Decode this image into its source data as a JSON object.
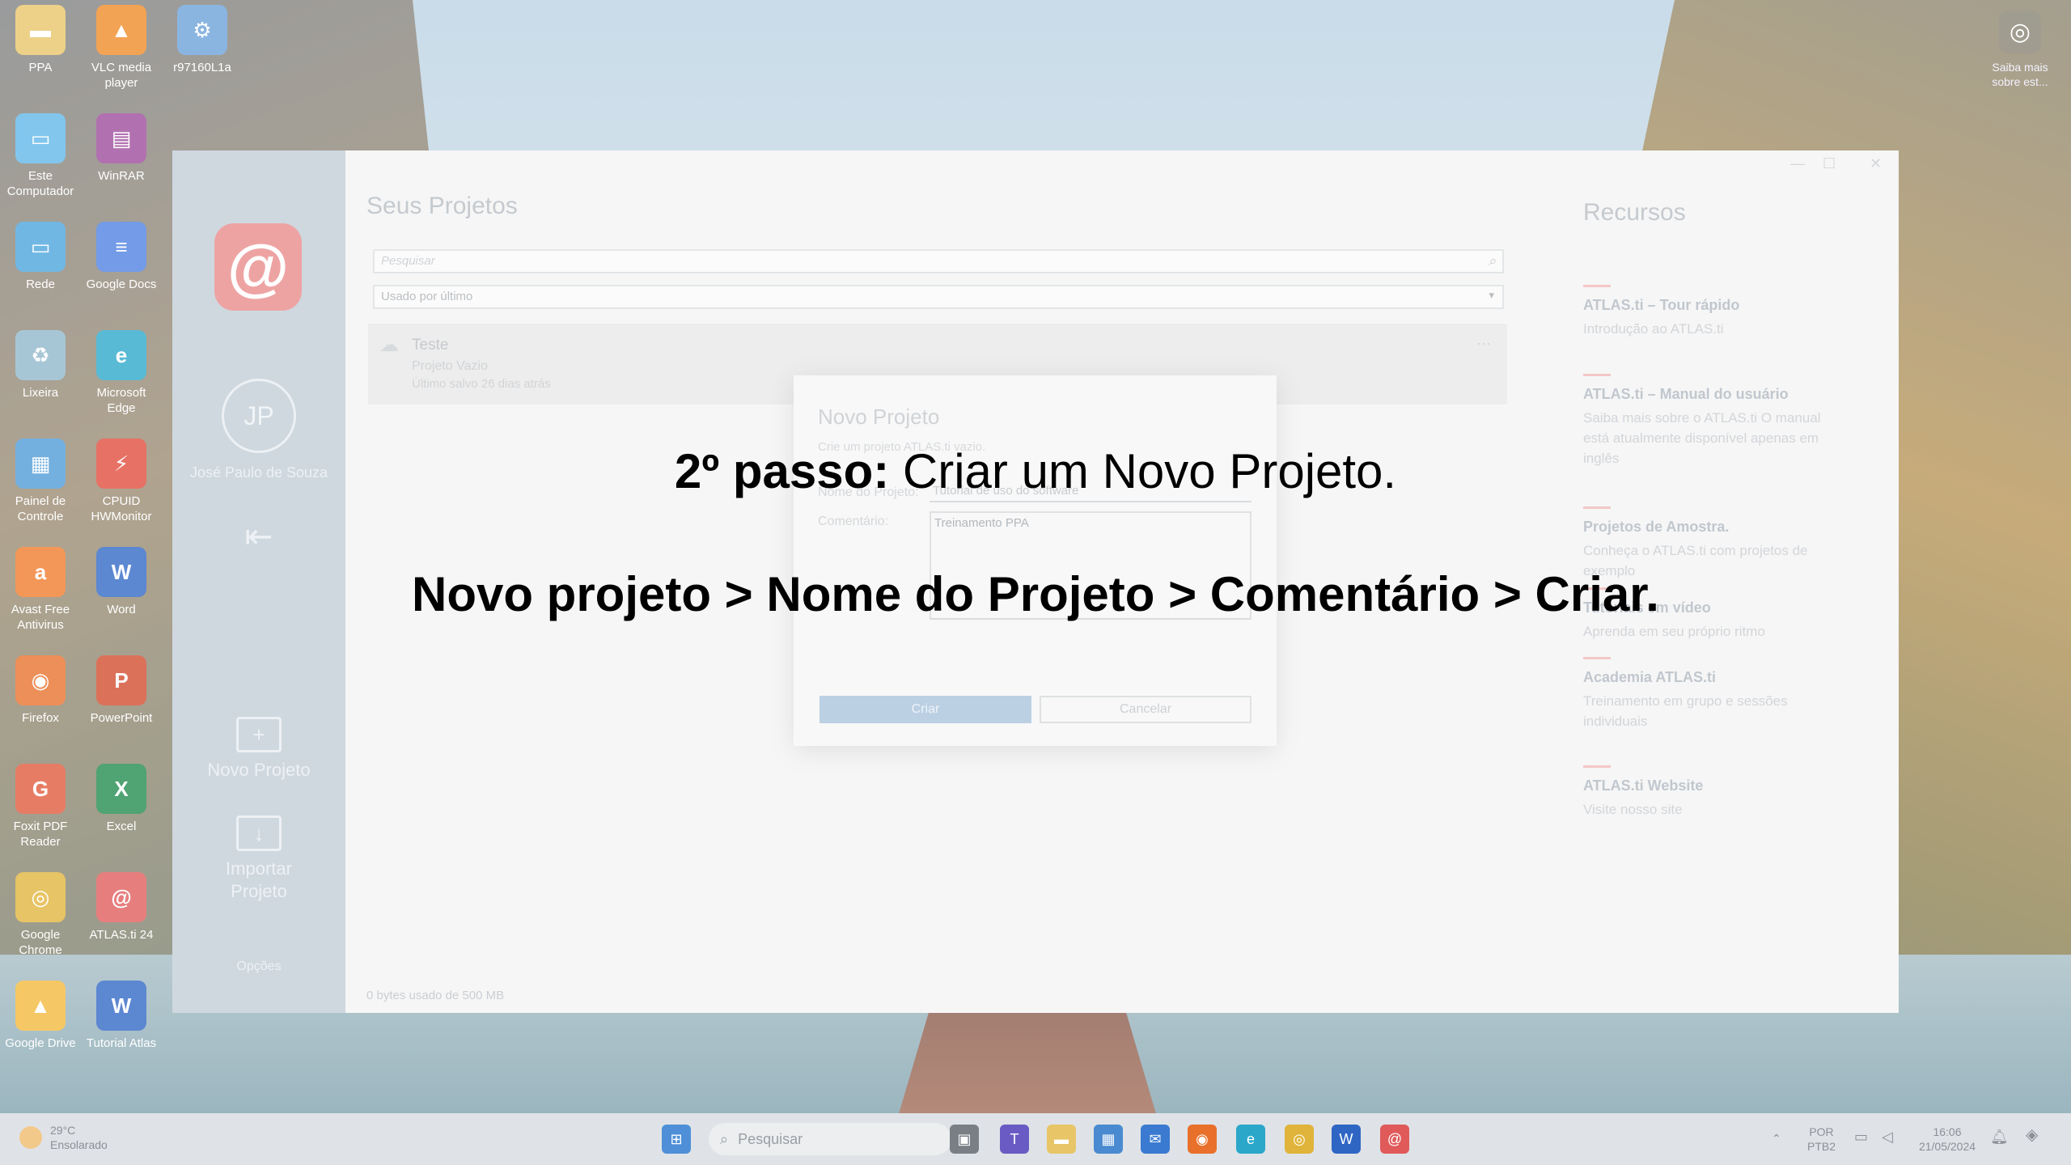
{
  "desktop": {
    "icons": [
      {
        "label": "PPA",
        "icon": "folder-icon",
        "color": "#e8c567",
        "glyph": "▬"
      },
      {
        "label": "VLC media player",
        "icon": "vlc-icon",
        "color": "#f08a24",
        "glyph": "▲"
      },
      {
        "label": "r97160L1a",
        "icon": "installer-icon",
        "color": "#6aa0d8",
        "glyph": "⚙"
      },
      {
        "label": "Este Computador",
        "icon": "computer-icon",
        "color": "#5fb7e8",
        "glyph": "▭"
      },
      {
        "label": "WinRAR",
        "icon": "winrar-icon",
        "color": "#9b4a9a",
        "glyph": "▤"
      },
      {
        "label": "Rede",
        "icon": "network-icon",
        "color": "#4aa3dd",
        "glyph": "▭"
      },
      {
        "label": "Google Docs",
        "icon": "google-docs-icon",
        "color": "#4c7fe0",
        "glyph": "≡"
      },
      {
        "label": "Lixeira",
        "icon": "recycle-bin-icon",
        "color": "#8fb6c9",
        "glyph": "♻"
      },
      {
        "label": "Microsoft Edge",
        "icon": "edge-icon",
        "color": "#2aa7c9",
        "glyph": "e"
      },
      {
        "label": "Painel de Controle",
        "icon": "control-panel-icon",
        "color": "#4d9ad6",
        "glyph": "▦"
      },
      {
        "label": "CPUID HWMonitor",
        "icon": "hwmonitor-icon",
        "color": "#e04a3a",
        "glyph": "⚡"
      },
      {
        "label": "Avast Free Antivirus",
        "icon": "avast-icon",
        "color": "#f07a2a",
        "glyph": "a"
      },
      {
        "label": "Word",
        "icon": "word-icon",
        "color": "#2f66c4",
        "glyph": "W"
      },
      {
        "label": "Firefox",
        "icon": "firefox-icon",
        "color": "#e8702a",
        "glyph": "◉"
      },
      {
        "label": "PowerPoint",
        "icon": "powerpoint-icon",
        "color": "#d24a2c",
        "glyph": "P"
      },
      {
        "label": "Foxit PDF Reader",
        "icon": "foxit-icon",
        "color": "#e0583a",
        "glyph": "G"
      },
      {
        "label": "Excel",
        "icon": "excel-icon",
        "color": "#1f8a4c",
        "glyph": "X"
      },
      {
        "label": "Google Chrome",
        "icon": "chrome-icon",
        "color": "#e0b43a",
        "glyph": "◎"
      },
      {
        "label": "ATLAS.ti 24",
        "icon": "atlas-ti-icon",
        "color": "#e05a5a",
        "glyph": "@"
      },
      {
        "label": "Google Drive",
        "icon": "google-drive-icon",
        "color": "#f2b93a",
        "glyph": "▲"
      },
      {
        "label": "Tutorial Atlas",
        "icon": "word-document-icon",
        "color": "#2f66c4",
        "glyph": "W"
      }
    ],
    "top_right": {
      "label": "Saiba mais sobre est...",
      "icon": "camera-icon"
    }
  },
  "app": {
    "logo": "@",
    "avatar_initials": "JP",
    "user_name": "José Paulo de Souza",
    "sidebar": {
      "new_project": "Novo Projeto",
      "import_project": "Importar Projeto",
      "options": "Opções"
    },
    "main": {
      "title": "Seus Projetos",
      "search_placeholder": "Pesquisar",
      "sort_value": "Usado por último",
      "project": {
        "name": "Teste",
        "type": "Projeto Vazio",
        "saved": "Último salvo 26 dias atrás"
      },
      "usage": "0 bytes usado de 500 MB"
    },
    "resources": {
      "title": "Recursos",
      "items": [
        {
          "title": "ATLAS.ti – Tour rápido",
          "desc": "Introdução ao ATLAS.ti"
        },
        {
          "title": "ATLAS.ti – Manual do usuário",
          "desc": "Saiba mais sobre o ATLAS.ti O manual está atualmente disponível apenas em inglês"
        },
        {
          "title": "Projetos de Amostra.",
          "desc": "Conheça o ATLAS.ti com projetos de exemplo"
        },
        {
          "title": "Tutoriais em vídeo",
          "desc": "Aprenda em seu próprio ritmo"
        },
        {
          "title": "Academia ATLAS.ti",
          "desc": "Treinamento em grupo e sessões individuais"
        },
        {
          "title": "ATLAS.ti Website",
          "desc": "Visite nosso site"
        }
      ]
    },
    "dialog": {
      "title": "Novo Projeto",
      "subtitle": "Crie um projeto ATLAS.ti vazio.",
      "name_label": "Nome do Projeto:",
      "name_value": "Tutorial de uso do software",
      "comment_label": "Comentário:",
      "comment_value": "Treinamento PPA",
      "create": "Criar",
      "cancel": "Cancelar"
    }
  },
  "overlay": {
    "step_bold": "2º passo:",
    "step_text": " Criar um Novo Projeto.",
    "path": "Novo projeto > Nome do Projeto > Comentário > Criar."
  },
  "taskbar": {
    "weather_temp": "29°C",
    "weather_desc": "Ensolarado",
    "search_placeholder": "Pesquisar",
    "lang_top": "POR",
    "lang_bottom": "PTB2",
    "time": "16:06",
    "date": "21/05/2024"
  }
}
